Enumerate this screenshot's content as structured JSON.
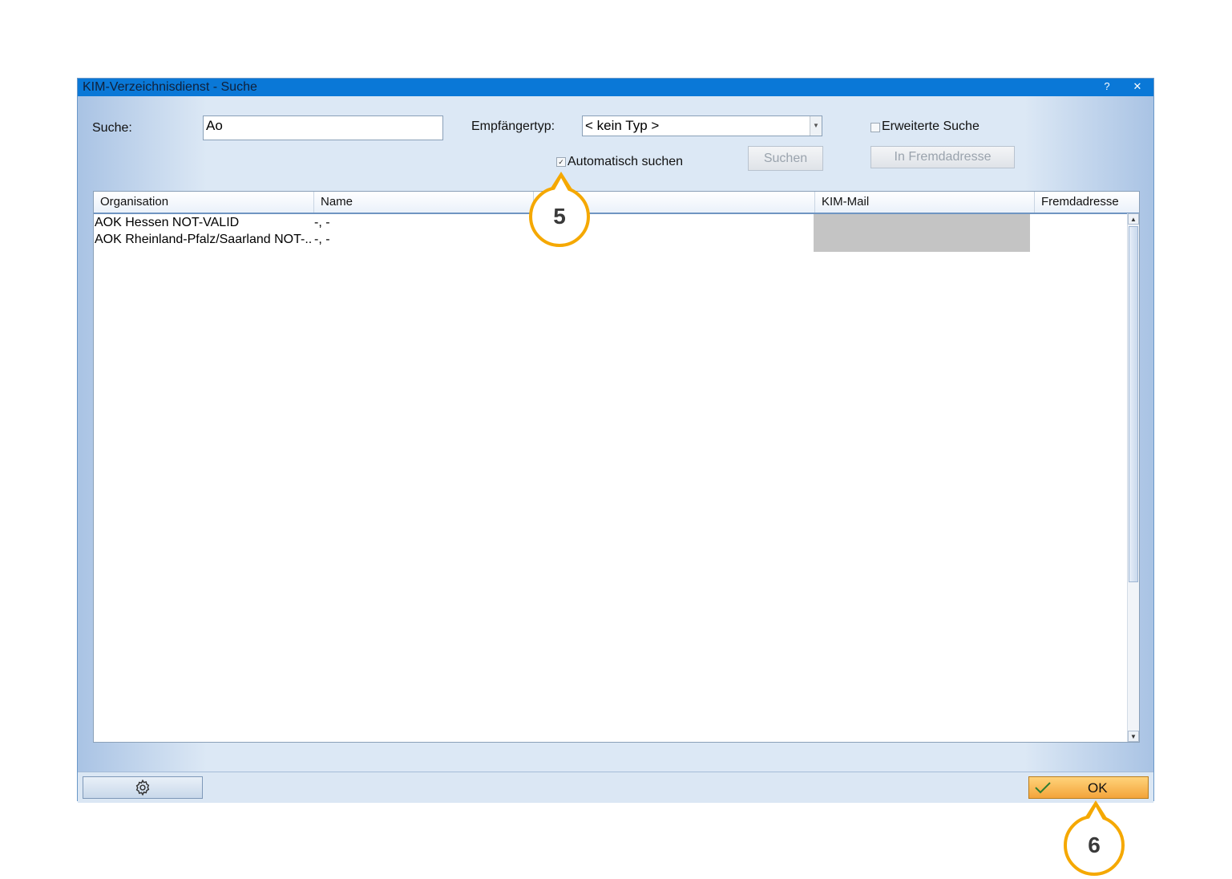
{
  "window": {
    "title": "KIM-Verzeichnisdienst - Suche",
    "help": "?",
    "close": "✕"
  },
  "search": {
    "label": "Suche:",
    "value": "Ao"
  },
  "recipient": {
    "label": "Empfängertyp:",
    "value": "< kein Typ >"
  },
  "extended": {
    "label": "Erweiterte Suche",
    "checked": false
  },
  "auto": {
    "label": "Automatisch suchen",
    "checked": true,
    "mark": "✓"
  },
  "buttons": {
    "search": "Suchen",
    "foreign": "In Fremdadresse",
    "ok": "OK"
  },
  "table": {
    "columns": [
      "Organisation",
      "Name",
      "",
      "KIM-Mail",
      "Fremdadresse"
    ],
    "rows": [
      {
        "organisation": "AOK Hessen NOT-VALID",
        "name": "-, -"
      },
      {
        "organisation": "AOK Rheinland-Pfalz/Saarland NOT-..",
        "name": "-, -"
      }
    ]
  },
  "scroll": {
    "up": "▲",
    "down": "▼"
  },
  "callouts": {
    "c5": "5",
    "c6": "6"
  },
  "colors": {
    "titlebar": "#0a78d7",
    "accent": "#f5a800",
    "ok": "#f3a43b"
  }
}
